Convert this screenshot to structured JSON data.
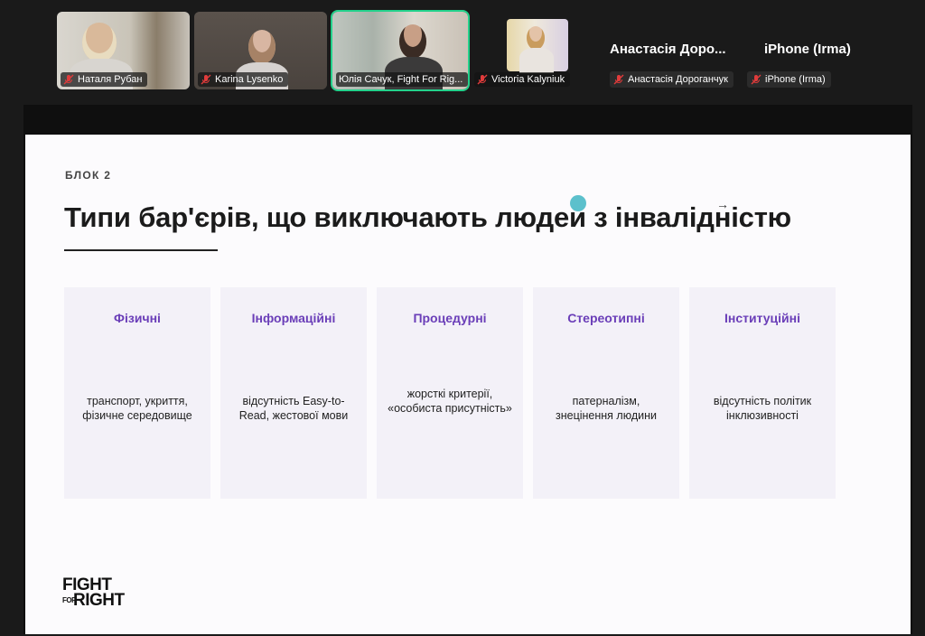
{
  "participants": [
    {
      "name": "Наталя Рубан",
      "muted": true
    },
    {
      "name": "Karina Lysenko",
      "muted": true
    },
    {
      "name": "Юлія Сачук, Fight For Rig...",
      "muted": false,
      "active_speaker": true
    },
    {
      "name": "Victoria Kalyniuk",
      "muted": true
    }
  ],
  "name_only_participants": [
    {
      "display_name": "Анастасія Доро...",
      "chip_name": "Анастасія Дороганчук",
      "muted": true
    },
    {
      "display_name": "iPhone (Irma)",
      "chip_name": "iPhone (Irma)",
      "muted": true
    }
  ],
  "slide": {
    "kicker": "БЛОК 2",
    "title": "Типи бар'єрів, що виключають людей з інвалідністю",
    "cards": [
      {
        "title": "Фізичні",
        "text": "транспорт, укриття, фізичне середовище"
      },
      {
        "title": "Інформаційні",
        "text": "відсутність Easy-to-Read, жестової мови"
      },
      {
        "title": "Процедурні",
        "text": "жорсткі критерії, «особиста присутність»"
      },
      {
        "title": "Стереотипні",
        "text": "патерналізм, знецінення людини"
      },
      {
        "title": "Інституційні",
        "text": "відсутність політик інклюзивності"
      }
    ],
    "logo": {
      "line1": "FIGHT",
      "line2_small": "FOR",
      "line2": "RIGHT"
    }
  },
  "colors": {
    "accent_purple": "#6a3eb8",
    "active_speaker_border": "#23d18b",
    "muted_icon": "#e03b3b"
  }
}
